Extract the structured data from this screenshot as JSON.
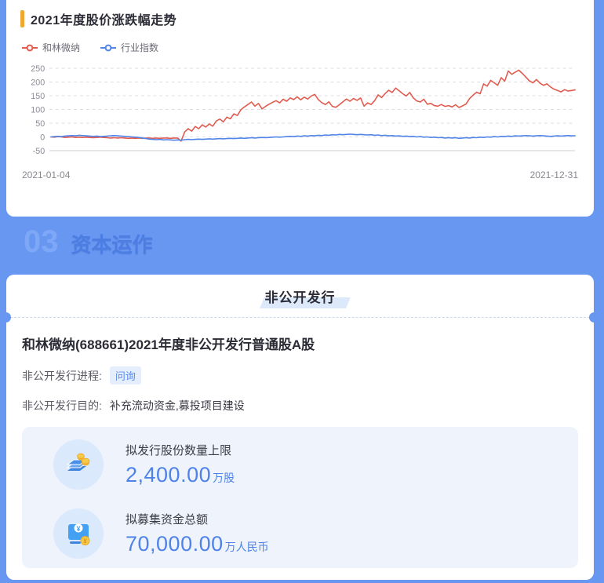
{
  "page": {
    "bg_color": "#6897f2",
    "accent_color": "#f0a732"
  },
  "chart_card": {
    "title": "2021年度股价涨跌幅走势",
    "legend": [
      {
        "label": "和林微纳",
        "color": "#e25a4e"
      },
      {
        "label": "行业指数",
        "color": "#5084e8"
      }
    ],
    "x_start_label": "2021-01-04",
    "x_end_label": "2021-12-31"
  },
  "chart_data": {
    "type": "line",
    "title": "2021年度股价涨跌幅走势",
    "x_range": [
      "2021-01-04",
      "2021-12-31"
    ],
    "unit": "%",
    "ylim": [
      -50,
      250
    ],
    "yticks": [
      250,
      200,
      150,
      100,
      50,
      0,
      -50
    ],
    "grid": "horizontal dashed",
    "legend_position": "top-left",
    "series": [
      {
        "name": "和林微纳",
        "color": "#e25a4e",
        "values": [
          0,
          -1,
          1,
          0,
          -2,
          -1,
          0,
          -2,
          -1,
          -2,
          -1,
          -2,
          -3,
          -2,
          -1,
          -2,
          -3,
          -4,
          -3,
          -4,
          -3,
          -4,
          -5,
          -4,
          -5,
          -4,
          -5,
          -4,
          -4,
          -5,
          -4,
          -5,
          -4,
          -4,
          -5,
          -4,
          -4,
          -15,
          18,
          30,
          21,
          38,
          30,
          44,
          36,
          47,
          39,
          58,
          65,
          55,
          72,
          66,
          84,
          78,
          99,
          109,
          118,
          127,
          112,
          122,
          102,
          111,
          119,
          126,
          132,
          124,
          137,
          130,
          142,
          136,
          146,
          135,
          145,
          138,
          149,
          155,
          136,
          125,
          118,
          128,
          111,
          108,
          117,
          128,
          138,
          130,
          140,
          133,
          142,
          112,
          124,
          118,
          132,
          153,
          143,
          158,
          170,
          162,
          178,
          168,
          157,
          149,
          162,
          142,
          131,
          127,
          137,
          119,
          122,
          114,
          112,
          118,
          111,
          114,
          109,
          117,
          107,
          113,
          120,
          140,
          152,
          163,
          157,
          193,
          185,
          206,
          197,
          188,
          216,
          203,
          240,
          228,
          236,
          243,
          231,
          218,
          204,
          197,
          209,
          196,
          188,
          193,
          182,
          174,
          169,
          164,
          172,
          167,
          169,
          171
        ]
      },
      {
        "name": "行业指数",
        "color": "#5084e8",
        "values": [
          0,
          1,
          2,
          1,
          3,
          4,
          5,
          4,
          6,
          5,
          4,
          3,
          2,
          3,
          1,
          2,
          3,
          4,
          5,
          4,
          3,
          2,
          1,
          0,
          -1,
          -2,
          -4,
          -6,
          -8,
          -9,
          -10,
          -9,
          -11,
          -10,
          -11,
          -12,
          -11,
          -12,
          -10,
          -9,
          -10,
          -9,
          -8,
          -9,
          -8,
          -7,
          -8,
          -7,
          -6,
          -7,
          -6,
          -5,
          -6,
          -5,
          -4,
          -5,
          -4,
          -3,
          -4,
          -3,
          -2,
          -3,
          -2,
          -1,
          0,
          -1,
          0,
          1,
          2,
          1,
          3,
          2,
          4,
          3,
          5,
          4,
          6,
          5,
          7,
          6,
          8,
          7,
          9,
          8,
          9,
          10,
          9,
          8,
          9,
          8,
          7,
          8,
          6,
          7,
          5,
          6,
          4,
          5,
          3,
          4,
          2,
          3,
          1,
          2,
          0,
          1,
          -1,
          0,
          -2,
          -1,
          -3,
          -2,
          -4,
          -3,
          -4,
          -3,
          -5,
          -4,
          -3,
          -4,
          -2,
          -3,
          -1,
          -2,
          0,
          -1,
          1,
          0,
          2,
          1,
          3,
          2,
          4,
          3,
          4,
          5,
          4,
          3,
          4,
          5,
          4,
          3,
          2,
          3,
          4,
          3,
          4,
          5,
          4,
          4
        ]
      }
    ]
  },
  "section": {
    "number": "03",
    "title": "资本运作"
  },
  "offering_card": {
    "header": "非公开发行",
    "title": "和林微纳(688661)2021年度非公开发行普通股A股",
    "progress_label": "非公开发行进程:",
    "progress_value": "问询",
    "purpose_label": "非公开发行目的:",
    "purpose_value": "补充流动资金,募投项目建设",
    "stats": [
      {
        "icon": "money-stack-icon",
        "label": "拟发行股份数量上限",
        "value": "2,400.00",
        "unit": "万股"
      },
      {
        "icon": "yuan-wallet-icon",
        "label": "拟募集资金总额",
        "value": "70,000.00",
        "unit": "万人民币"
      }
    ]
  }
}
